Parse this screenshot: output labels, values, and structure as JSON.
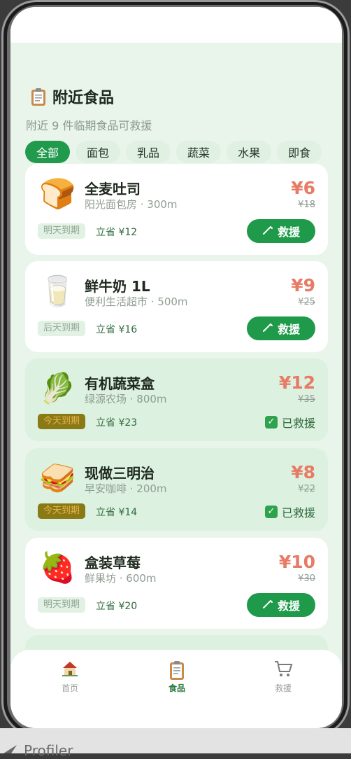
{
  "header": {
    "title": "附近食品",
    "subtitle": "附近 9 件临期食品可救援",
    "title_icon": "clipboard-icon"
  },
  "filters": {
    "chips": [
      "全部",
      "面包",
      "乳品",
      "蔬菜",
      "水果",
      "即食"
    ],
    "active_index": 0
  },
  "items": [
    {
      "emoji": "🍞",
      "name": "全麦吐司",
      "shop": "阳光面包房 · 300m",
      "price": "¥6",
      "original_price": "¥18",
      "expiry": "明天到期",
      "saving": "立省 ¥12",
      "status": "rescue",
      "action_label": "救援"
    },
    {
      "emoji": "🥛",
      "name": "鲜牛奶 1L",
      "shop": "便利生活超市 · 500m",
      "price": "¥9",
      "original_price": "¥25",
      "expiry": "后天到期",
      "saving": "立省 ¥16",
      "status": "rescue",
      "action_label": "救援"
    },
    {
      "emoji": "🥬",
      "name": "有机蔬菜盒",
      "shop": "绿源农场 · 800m",
      "price": "¥12",
      "original_price": "¥35",
      "expiry": "今天到期",
      "saving": "立省 ¥23",
      "status": "rescued",
      "action_label": "已救援"
    },
    {
      "emoji": "🥪",
      "name": "现做三明治",
      "shop": "早安咖啡 · 200m",
      "price": "¥8",
      "original_price": "¥22",
      "expiry": "今天到期",
      "saving": "立省 ¥14",
      "status": "rescued",
      "action_label": "已救援"
    },
    {
      "emoji": "🍓",
      "name": "盒装草莓",
      "shop": "鲜果坊 · 600m",
      "price": "¥10",
      "original_price": "¥30",
      "expiry": "明天到期",
      "saving": "立省 ¥20",
      "status": "rescue",
      "action_label": "救援"
    }
  ],
  "tabbar": {
    "tabs": [
      {
        "label": "首页",
        "icon": "house-icon"
      },
      {
        "label": "食品",
        "icon": "clipboard-icon"
      },
      {
        "label": "救援",
        "icon": "cart-icon"
      }
    ],
    "active_index": 1
  },
  "devtools": {
    "label": "Profiler"
  },
  "colors": {
    "accent": "#219a4e",
    "price": "#e77b66",
    "background": "#e9f5ea",
    "urgent_badge": "#8a7a16"
  }
}
